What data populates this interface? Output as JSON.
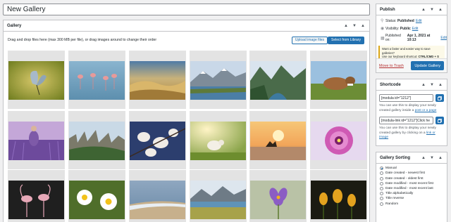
{
  "title_input": {
    "value": "New Gallery"
  },
  "gallery": {
    "heading": "Gallery",
    "drop_text": "Drag and drop files here (max 300 MB per file), or drag images around to change their order",
    "upload_label": "Upload image files",
    "select_label": "Select from Library",
    "images": [
      "butterfly",
      "flamingos",
      "desert-dunes",
      "mountain-lake",
      "alpine-river",
      "resting-cow",
      "lavender-field",
      "rock-pillars",
      "white-magnolias",
      "lamb-in-meadow",
      "sunset-dog",
      "pink-flower",
      "flamingo-pair",
      "daisies",
      "beach-shore",
      "mountain-lake-meadow",
      "purple-crocus",
      "orange-tulips"
    ]
  },
  "publish": {
    "heading": "Publish",
    "status_label": "Status:",
    "status_value": "Published",
    "visibility_label": "Visibility:",
    "visibility_value": "Public",
    "published_label": "Published on:",
    "published_value": "Apr 1, 2021 at 10:13",
    "edit": "Edit",
    "notice_line1": "Want a faster and easier way to save galleries?",
    "notice_line2": "Use our keyboard shortcut:",
    "shortcut": "CTRL/CMD + S",
    "trash": "Move to Trash",
    "update": "Update Gallery"
  },
  "shortcode": {
    "heading": "Shortcode",
    "code1": "[modula id=\"1212\"]",
    "help1_pre": "You can use this to display your newly created gallery inside a",
    "help1_link": "post or a page",
    "code2": "[modula-link id=\"1212\"]Click he",
    "help2_pre": "You can use this to display your newly created gallery by clicking on a",
    "help2_link": "link or image"
  },
  "sorting": {
    "heading": "Gallery Sorting",
    "options": [
      "Manual",
      "Date created - newest first",
      "Date created - oldest first",
      "Date modified - most recent first",
      "Date modified - most recent last",
      "Title alphabetically",
      "Title reverse",
      "Random"
    ],
    "selected": "Manual"
  },
  "colors": {
    "accent": "#2271b1",
    "trash": "#b32d2e",
    "notice": "#dba617"
  }
}
